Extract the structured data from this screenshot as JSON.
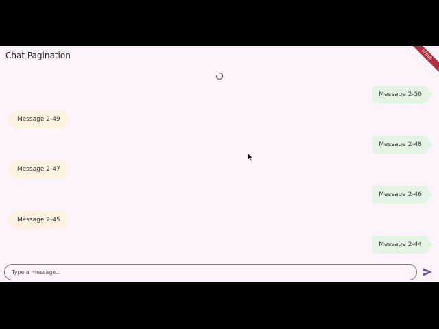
{
  "app_bar": {
    "title": "Chat Pagination",
    "debug_banner": "DEBUG"
  },
  "loading": true,
  "messages": [
    {
      "text": "Message 2-50",
      "side": "sent"
    },
    {
      "text": "Message 2-49",
      "side": "received"
    },
    {
      "text": "Message 2-48",
      "side": "sent"
    },
    {
      "text": "Message 2-47",
      "side": "received"
    },
    {
      "text": "Message 2-46",
      "side": "sent"
    },
    {
      "text": "Message 2-45",
      "side": "received"
    },
    {
      "text": "Message 2-44",
      "side": "sent"
    }
  ],
  "composer": {
    "placeholder": "Type a message...",
    "value": ""
  },
  "icons": {
    "send": "send-icon",
    "loading": "loading-spinner-icon",
    "cursor": "mouse-cursor-icon"
  },
  "colors": {
    "background": "#fdf3fb",
    "sent_bubble": "#e4f4e2",
    "received_bubble": "#fdf1df",
    "accent": "#6750a4",
    "debug_ribbon": "#b0303f"
  }
}
